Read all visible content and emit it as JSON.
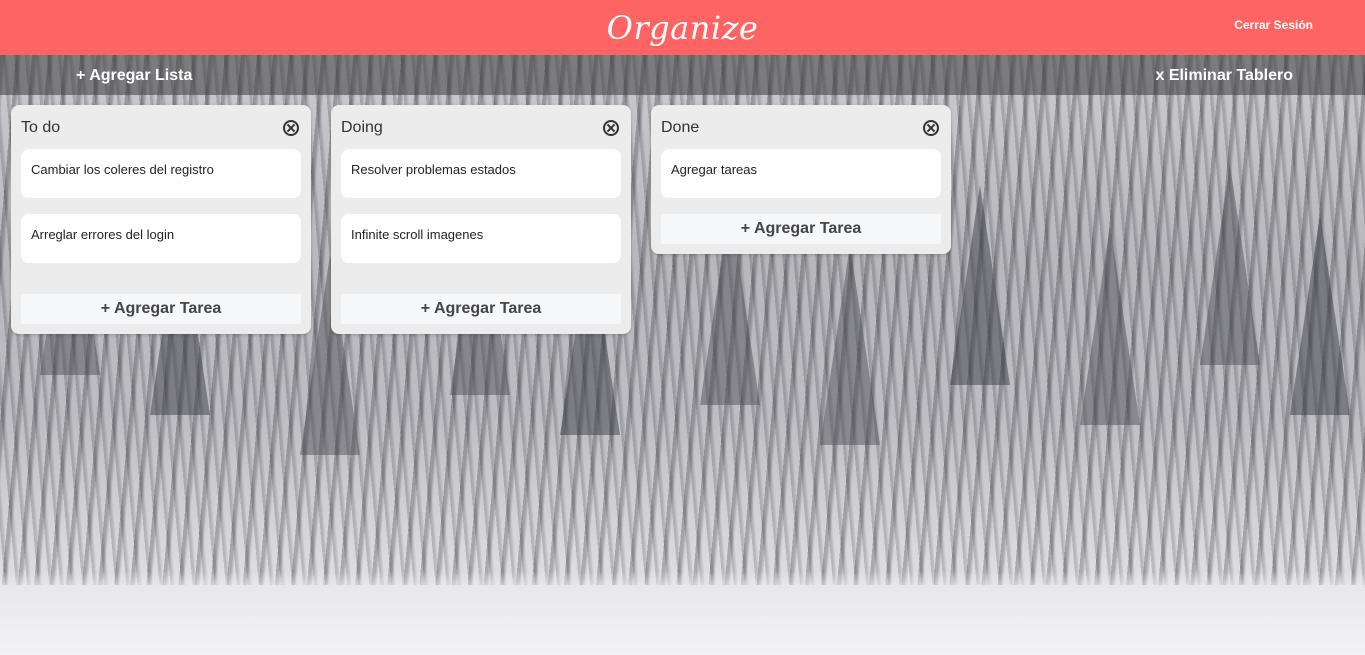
{
  "header": {
    "brand": "Organize",
    "logout_label": "Cerrar Sesión",
    "accent_color": "#ff6464"
  },
  "toolbar": {
    "add_list_label": "+ Agregar Lista",
    "delete_board_label": "x Eliminar Tablero"
  },
  "lists": [
    {
      "title": "To do",
      "cards": [
        "Cambiar los coleres del registro",
        "Arreglar errores del login"
      ],
      "add_task_label": "+ Agregar Tarea"
    },
    {
      "title": "Doing",
      "cards": [
        "Resolver problemas estados",
        "Infinite scroll imagenes"
      ],
      "add_task_label": "+ Agregar Tarea"
    },
    {
      "title": "Done",
      "cards": [
        "Agregar tareas"
      ],
      "add_task_label": "+ Agregar Tarea"
    }
  ],
  "icons": {
    "list_close": "close-circle-icon"
  }
}
